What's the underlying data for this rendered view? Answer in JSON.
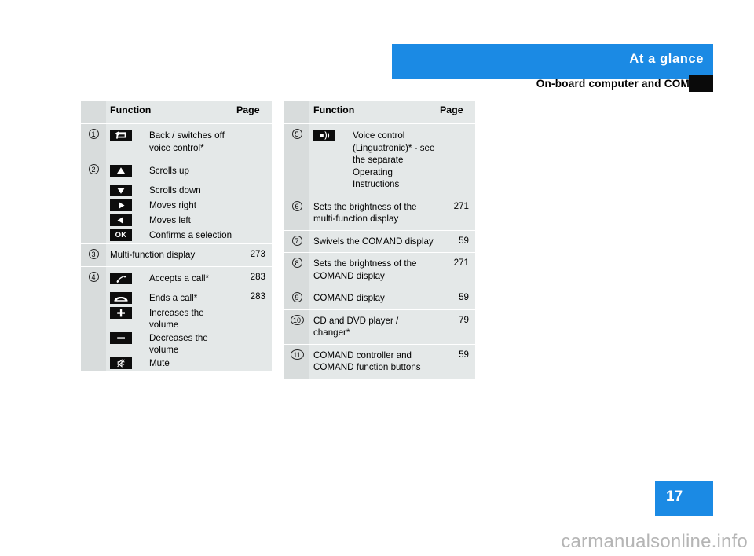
{
  "header": {
    "section_title": "At a glance",
    "subtitle": "On-board computer and COMAND",
    "bar_color": "#1b8ae4",
    "tab_marker_color": "#0a0a0a"
  },
  "tables": {
    "left": {
      "columns": {
        "function": "Function",
        "page": "Page"
      },
      "rows": [
        {
          "number": "1",
          "entries": [
            {
              "icon": "back-arrow-icon",
              "text": "Back / switches off voice control*",
              "page": ""
            }
          ]
        },
        {
          "number": "2",
          "entries": [
            {
              "icon": "arrow-up-icon",
              "text": "Scrolls up",
              "page": ""
            },
            {
              "icon": "arrow-down-icon",
              "text": "Scrolls down",
              "page": ""
            },
            {
              "icon": "arrow-right-icon",
              "text": "Moves right",
              "page": ""
            },
            {
              "icon": "arrow-left-icon",
              "text": "Moves left",
              "page": ""
            },
            {
              "icon": "ok-button-icon",
              "text": "Confirms a selection",
              "page": ""
            }
          ]
        },
        {
          "number": "3",
          "entries": [
            {
              "icon": "",
              "text": "Multi-function display",
              "page": "273"
            }
          ]
        },
        {
          "number": "4",
          "entries": [
            {
              "icon": "phone-accept-icon",
              "text": "Accepts a call*",
              "page": "283"
            },
            {
              "icon": "phone-end-icon",
              "text": "Ends a call*",
              "page": "283"
            },
            {
              "icon": "plus-icon",
              "text": "Increases the volume",
              "page": ""
            },
            {
              "icon": "minus-icon",
              "text": "Decreases the volume",
              "page": ""
            },
            {
              "icon": "mute-icon",
              "text": "Mute",
              "page": ""
            }
          ]
        }
      ]
    },
    "right": {
      "columns": {
        "function": "Function",
        "page": "Page"
      },
      "rows": [
        {
          "number": "5",
          "entries": [
            {
              "icon": "voice-control-icon",
              "text": "Voice control (Linguatronic)* - see the separate Operating Instructions",
              "page": ""
            }
          ]
        },
        {
          "number": "6",
          "entries": [
            {
              "icon": "",
              "text": "Sets the brightness of the multi-function display",
              "page": "271"
            }
          ]
        },
        {
          "number": "7",
          "entries": [
            {
              "icon": "",
              "text": "Swivels the COMAND display",
              "page": "59"
            }
          ]
        },
        {
          "number": "8",
          "entries": [
            {
              "icon": "",
              "text": "Sets the brightness of the COMAND display",
              "page": "271"
            }
          ]
        },
        {
          "number": "9",
          "entries": [
            {
              "icon": "",
              "text": "COMAND display",
              "page": "59"
            }
          ]
        },
        {
          "number": "10",
          "entries": [
            {
              "icon": "",
              "text": "CD and DVD player / changer*",
              "page": "79"
            }
          ]
        },
        {
          "number": "11",
          "entries": [
            {
              "icon": "",
              "text": "COMAND controller and COMAND function buttons",
              "page": "59"
            }
          ]
        }
      ]
    }
  },
  "footer": {
    "page_number": "17",
    "watermark": "carmanualsonline.info",
    "badge_color": "#1b8ae4"
  },
  "icons": {
    "ok_label": "OK"
  }
}
